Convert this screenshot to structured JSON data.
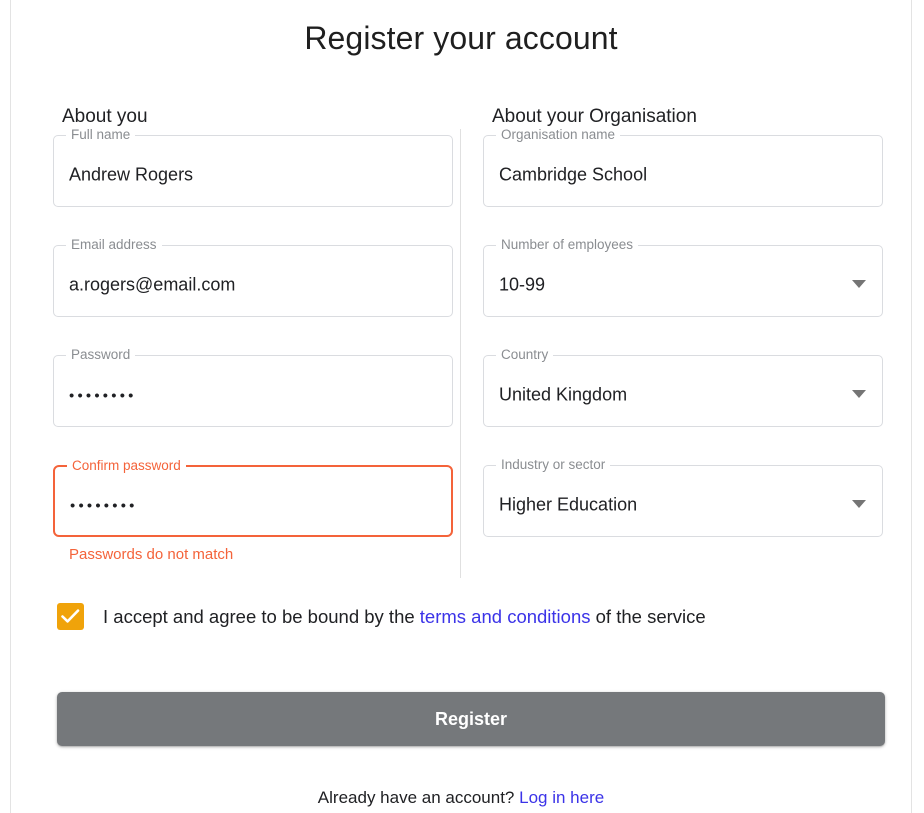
{
  "page": {
    "title": "Register your account"
  },
  "sections": {
    "about_you": {
      "heading": "About you",
      "fields": [
        {
          "label": "Full name",
          "value": "Andrew Rogers",
          "type": "text"
        },
        {
          "label": "Email address",
          "value": "a.rogers@email.com",
          "type": "email"
        },
        {
          "label": "Password",
          "value": "••••••••",
          "type": "password"
        },
        {
          "label": "Confirm password",
          "value": "••••••••",
          "type": "password",
          "error": "Passwords do not match"
        }
      ]
    },
    "about_organisation": {
      "heading": "About your Organisation",
      "fields": [
        {
          "label": "Organisation name",
          "value": "Cambridge School",
          "type": "text"
        },
        {
          "label": "Number of employees",
          "value": "10-99",
          "type": "select"
        },
        {
          "label": "Country",
          "value": "United Kingdom",
          "type": "select"
        },
        {
          "label": "Industry or sector",
          "value": "Higher Education",
          "type": "select"
        }
      ]
    }
  },
  "terms": {
    "checked": true,
    "text_before": "I accept and agree to be bound by the",
    "link_text": "terms and conditions",
    "text_after": "of the service"
  },
  "submit": {
    "label": "Register"
  },
  "footer": {
    "text": "Already have an account?",
    "link_text": "Log in here"
  },
  "colors": {
    "error": "#f4633a",
    "checkbox": "#f0a30a",
    "link": "#3b33e8",
    "button": "#75787b"
  }
}
